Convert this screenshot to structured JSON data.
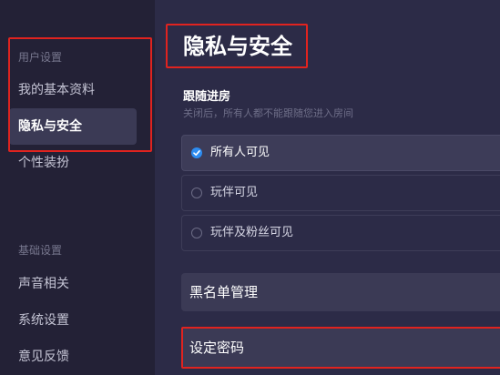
{
  "sidebar": {
    "groups": [
      {
        "title": "用户设置",
        "items": [
          {
            "label": "我的基本资料"
          },
          {
            "label": "隐私与安全"
          },
          {
            "label": "个性装扮"
          }
        ]
      },
      {
        "title": "基础设置",
        "items": [
          {
            "label": "声音相关"
          },
          {
            "label": "系统设置"
          },
          {
            "label": "意见反馈"
          }
        ]
      }
    ],
    "active_item": "隐私与安全"
  },
  "main": {
    "title": "隐私与安全",
    "follow": {
      "title": "跟随进房",
      "description": "关闭后，所有人都不能跟随您进入房间",
      "options": [
        {
          "label": "所有人可见",
          "selected": true
        },
        {
          "label": "玩伴可见",
          "selected": false
        },
        {
          "label": "玩伴及粉丝可见",
          "selected": false
        }
      ]
    },
    "blacklist_label": "黑名单管理",
    "password_label": "设定密码"
  },
  "colors": {
    "accent": "#2d8cf0",
    "highlight_border": "#e0231f",
    "sidebar_bg": "#232136",
    "main_bg": "#2c2b47"
  }
}
